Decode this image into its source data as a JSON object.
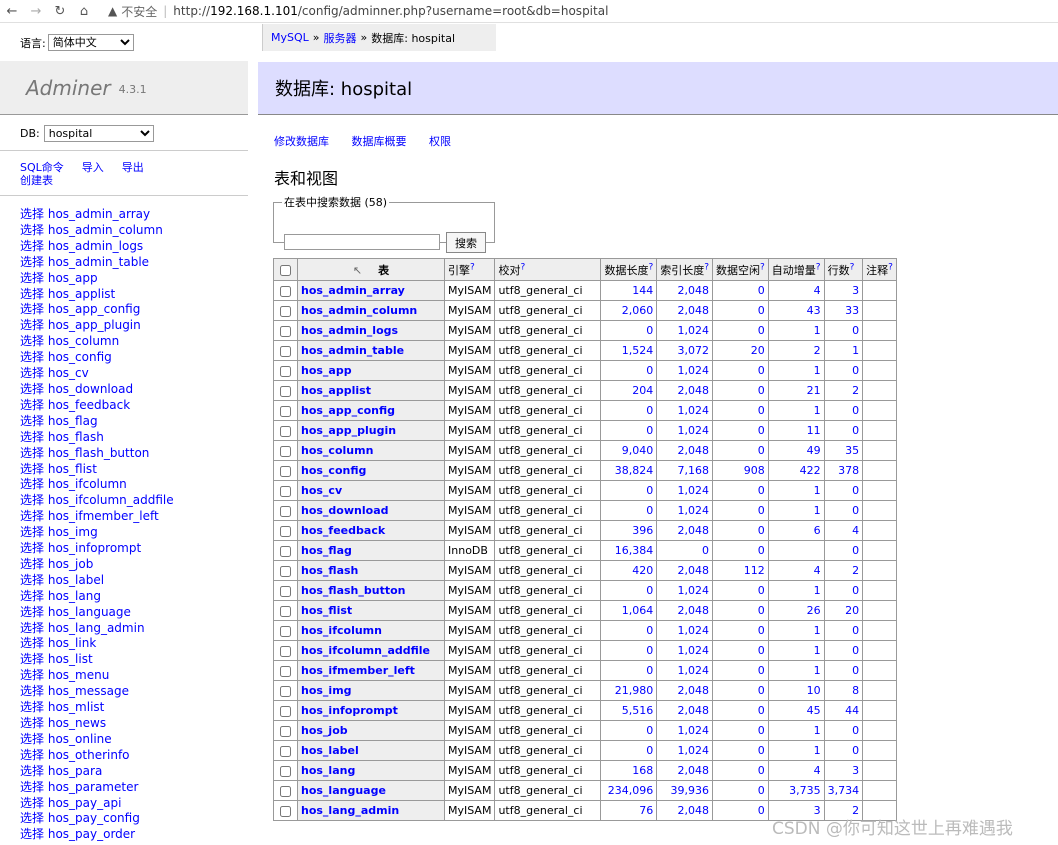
{
  "browser": {
    "security": "不安全",
    "url_prefix": "http://",
    "url_host": "192.168.1.101",
    "url_path": "/config/adminner.php?username=root&db=hospital"
  },
  "menu": {
    "lang_label": "语言:",
    "lang_value": "简体中文",
    "app_name": "Adminer",
    "version": "4.3.1",
    "db_label": "DB:",
    "db_value": "hospital",
    "links": [
      "SQL命令",
      "导入",
      "导出"
    ],
    "create_table": "创建表",
    "select_prefix": "选择",
    "tables": [
      "hos_admin_array",
      "hos_admin_column",
      "hos_admin_logs",
      "hos_admin_table",
      "hos_app",
      "hos_applist",
      "hos_app_config",
      "hos_app_plugin",
      "hos_column",
      "hos_config",
      "hos_cv",
      "hos_download",
      "hos_feedback",
      "hos_flag",
      "hos_flash",
      "hos_flash_button",
      "hos_flist",
      "hos_ifcolumn",
      "hos_ifcolumn_addfile",
      "hos_ifmember_left",
      "hos_img",
      "hos_infoprompt",
      "hos_job",
      "hos_label",
      "hos_lang",
      "hos_language",
      "hos_lang_admin",
      "hos_link",
      "hos_list",
      "hos_menu",
      "hos_message",
      "hos_mlist",
      "hos_news",
      "hos_online",
      "hos_otherinfo",
      "hos_para",
      "hos_parameter",
      "hos_pay_api",
      "hos_pay_config",
      "hos_pay_order"
    ]
  },
  "breadcrumb": {
    "mysql": "MySQL",
    "server": "服务器",
    "sep": "»",
    "current": "数据库: hospital"
  },
  "page": {
    "title": "数据库: hospital",
    "actions": [
      "修改数据库",
      "数据库概要",
      "权限"
    ],
    "section_title": "表和视图",
    "search_legend": "在表中搜索数据 (58)",
    "search_button": "搜索",
    "search_value": ""
  },
  "table": {
    "headers": {
      "table": "表",
      "engine": "引擎",
      "collation": "校对",
      "data_length": "数据长度",
      "index_length": "索引长度",
      "data_free": "数据空闲",
      "auto_increment": "自动增量",
      "rows": "行数",
      "comment": "注释",
      "help_mark": "?"
    },
    "rows": [
      [
        "hos_admin_array",
        "MyISAM",
        "utf8_general_ci",
        "144",
        "2,048",
        "0",
        "4",
        "3"
      ],
      [
        "hos_admin_column",
        "MyISAM",
        "utf8_general_ci",
        "2,060",
        "2,048",
        "0",
        "43",
        "33"
      ],
      [
        "hos_admin_logs",
        "MyISAM",
        "utf8_general_ci",
        "0",
        "1,024",
        "0",
        "1",
        "0"
      ],
      [
        "hos_admin_table",
        "MyISAM",
        "utf8_general_ci",
        "1,524",
        "3,072",
        "20",
        "2",
        "1"
      ],
      [
        "hos_app",
        "MyISAM",
        "utf8_general_ci",
        "0",
        "1,024",
        "0",
        "1",
        "0"
      ],
      [
        "hos_applist",
        "MyISAM",
        "utf8_general_ci",
        "204",
        "2,048",
        "0",
        "21",
        "2"
      ],
      [
        "hos_app_config",
        "MyISAM",
        "utf8_general_ci",
        "0",
        "1,024",
        "0",
        "1",
        "0"
      ],
      [
        "hos_app_plugin",
        "MyISAM",
        "utf8_general_ci",
        "0",
        "1,024",
        "0",
        "11",
        "0"
      ],
      [
        "hos_column",
        "MyISAM",
        "utf8_general_ci",
        "9,040",
        "2,048",
        "0",
        "49",
        "35"
      ],
      [
        "hos_config",
        "MyISAM",
        "utf8_general_ci",
        "38,824",
        "7,168",
        "908",
        "422",
        "378"
      ],
      [
        "hos_cv",
        "MyISAM",
        "utf8_general_ci",
        "0",
        "1,024",
        "0",
        "1",
        "0"
      ],
      [
        "hos_download",
        "MyISAM",
        "utf8_general_ci",
        "0",
        "1,024",
        "0",
        "1",
        "0"
      ],
      [
        "hos_feedback",
        "MyISAM",
        "utf8_general_ci",
        "396",
        "2,048",
        "0",
        "6",
        "4"
      ],
      [
        "hos_flag",
        "InnoDB",
        "utf8_general_ci",
        "16,384",
        "0",
        "0",
        "",
        "0"
      ],
      [
        "hos_flash",
        "MyISAM",
        "utf8_general_ci",
        "420",
        "2,048",
        "112",
        "4",
        "2"
      ],
      [
        "hos_flash_button",
        "MyISAM",
        "utf8_general_ci",
        "0",
        "1,024",
        "0",
        "1",
        "0"
      ],
      [
        "hos_flist",
        "MyISAM",
        "utf8_general_ci",
        "1,064",
        "2,048",
        "0",
        "26",
        "20"
      ],
      [
        "hos_ifcolumn",
        "MyISAM",
        "utf8_general_ci",
        "0",
        "1,024",
        "0",
        "1",
        "0"
      ],
      [
        "hos_ifcolumn_addfile",
        "MyISAM",
        "utf8_general_ci",
        "0",
        "1,024",
        "0",
        "1",
        "0"
      ],
      [
        "hos_ifmember_left",
        "MyISAM",
        "utf8_general_ci",
        "0",
        "1,024",
        "0",
        "1",
        "0"
      ],
      [
        "hos_img",
        "MyISAM",
        "utf8_general_ci",
        "21,980",
        "2,048",
        "0",
        "10",
        "8"
      ],
      [
        "hos_infoprompt",
        "MyISAM",
        "utf8_general_ci",
        "5,516",
        "2,048",
        "0",
        "45",
        "44"
      ],
      [
        "hos_job",
        "MyISAM",
        "utf8_general_ci",
        "0",
        "1,024",
        "0",
        "1",
        "0"
      ],
      [
        "hos_label",
        "MyISAM",
        "utf8_general_ci",
        "0",
        "1,024",
        "0",
        "1",
        "0"
      ],
      [
        "hos_lang",
        "MyISAM",
        "utf8_general_ci",
        "168",
        "2,048",
        "0",
        "4",
        "3"
      ],
      [
        "hos_language",
        "MyISAM",
        "utf8_general_ci",
        "234,096",
        "39,936",
        "0",
        "3,735",
        "3,734"
      ],
      [
        "hos_lang_admin",
        "MyISAM",
        "utf8_general_ci",
        "76",
        "2,048",
        "0",
        "3",
        "2"
      ]
    ]
  },
  "watermark": "CSDN @你可知这世上再难遇我"
}
